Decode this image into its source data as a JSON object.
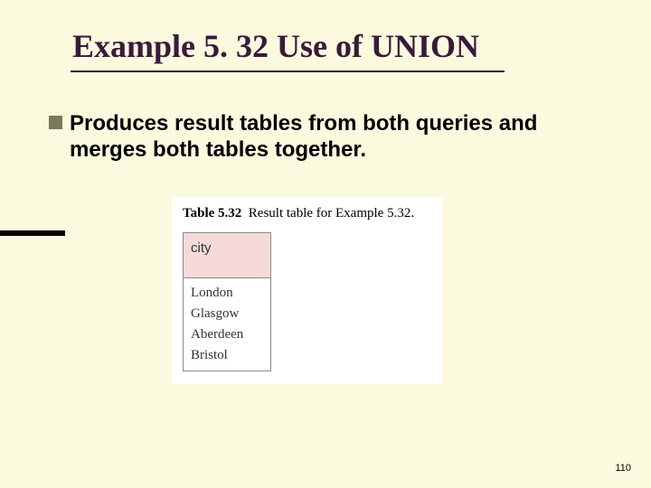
{
  "title": "Example 5. 32  Use of UNION",
  "bullet": {
    "line1": "Produces result tables from both queries and",
    "line2": "merges both tables together."
  },
  "figure": {
    "label_bold": "Table 5.32",
    "label_rest": "Result table for Example 5.32.",
    "header": "city",
    "rows": [
      "London",
      "Glasgow",
      "Aberdeen",
      "Bristol"
    ]
  },
  "page_number": "110"
}
